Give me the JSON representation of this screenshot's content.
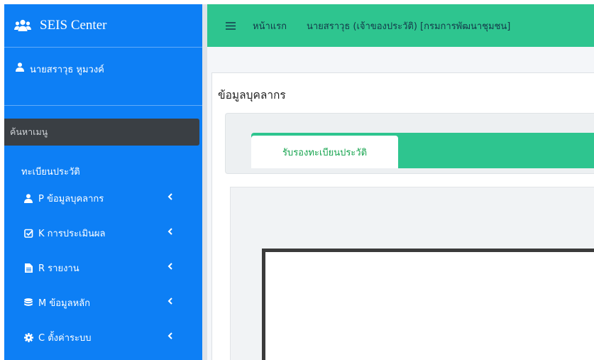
{
  "sidebar": {
    "brand": "SEIS Center",
    "user_name": "นายสราวุธ หูมวงค์",
    "search_placeholder": "ค้นหาเมนู",
    "menu_title": "ทะเบียนประวัติ",
    "items": [
      {
        "label": "P ข้อมูลบุคลากร",
        "icon": "user-icon"
      },
      {
        "label": "K การประเมินผล",
        "icon": "check-square-icon"
      },
      {
        "label": "R รายงาน",
        "icon": "file-icon"
      },
      {
        "label": "M ข้อมูลหลัก",
        "icon": "database-icon"
      },
      {
        "label": "C ตั้งค่าระบบ",
        "icon": "gear-icon"
      }
    ]
  },
  "topbar": {
    "home": "หน้าแรก",
    "current_user": "นายสราวุธ (เจ้าของประวัติ) [กรมการพัฒนาชุมชน]"
  },
  "content": {
    "title": "ข้อมูลบุคลากร",
    "tab_label": "รับรองทะเบียนประวัติ"
  },
  "colors": {
    "sidebar": "#0d7ff5",
    "topbar": "#2ec58f",
    "tab_text": "#17a44f",
    "search_bg": "#3a3f44"
  }
}
